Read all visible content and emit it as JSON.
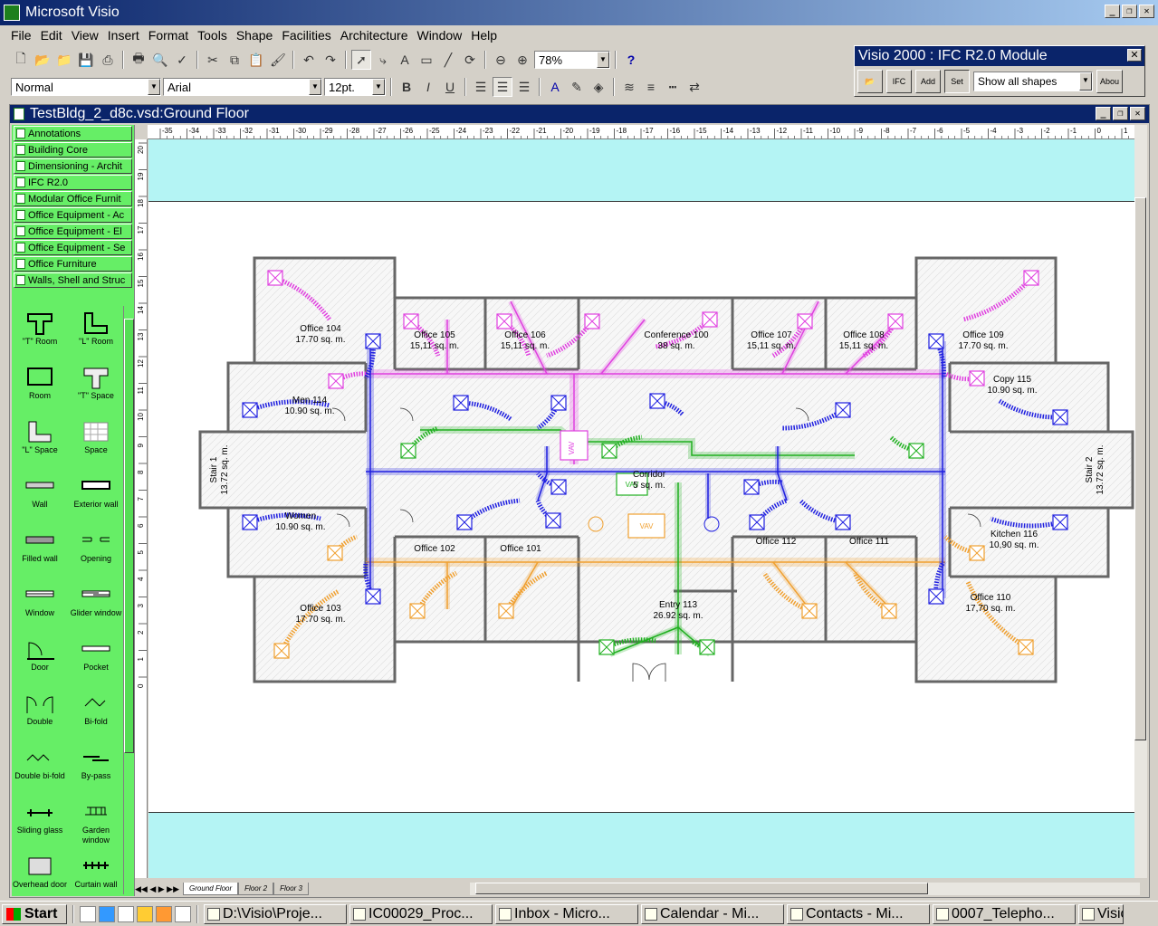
{
  "app": {
    "title": "Microsoft Visio"
  },
  "menu": [
    "File",
    "Edit",
    "View",
    "Insert",
    "Format",
    "Tools",
    "Shape",
    "Facilities",
    "Architecture",
    "Window",
    "Help"
  ],
  "toolbar": {
    "zoom": "78%",
    "style": "Normal",
    "font": "Arial",
    "size": "12pt.",
    "help": "?"
  },
  "ifc_panel": {
    "title": "Visio 2000 : IFC R2.0 Module",
    "buttons": [
      "IFC",
      "Add",
      "Set"
    ],
    "dropdown": "Show all shapes",
    "about": "Abou"
  },
  "document": {
    "title": "TestBldg_2_d8c.vsd:Ground Floor"
  },
  "stencils": [
    "Annotations",
    "Building Core",
    "Dimensioning - Archit",
    "IFC R2.0",
    "Modular Office Furnit",
    "Office Equipment - Ac",
    "Office Equipment - El",
    "Office Equipment - Se",
    "Office Furniture",
    "Walls, Shell and Struc"
  ],
  "shapes": [
    {
      "label": "\"T\" Room"
    },
    {
      "label": "\"L\" Room"
    },
    {
      "label": "Room"
    },
    {
      "label": "\"T\" Space"
    },
    {
      "label": "\"L\" Space"
    },
    {
      "label": "Space"
    },
    {
      "label": "Wall"
    },
    {
      "label": "Exterior wall"
    },
    {
      "label": "Filled wall"
    },
    {
      "label": "Opening"
    },
    {
      "label": "Window"
    },
    {
      "label": "Glider window"
    },
    {
      "label": "Door"
    },
    {
      "label": "Pocket"
    },
    {
      "label": "Double"
    },
    {
      "label": "Bi-fold"
    },
    {
      "label": "Double bi-fold"
    },
    {
      "label": "By-pass"
    },
    {
      "label": "Sliding glass"
    },
    {
      "label": "Garden window"
    },
    {
      "label": "Overhead door"
    },
    {
      "label": "Curtain wall"
    }
  ],
  "ruler_h": [
    "-35",
    "-34",
    "-33",
    "-32",
    "-31",
    "-30",
    "-29",
    "-28",
    "-27",
    "-26",
    "-25",
    "-24",
    "-23",
    "-22",
    "-21",
    "-20",
    "-19",
    "-18",
    "-17",
    "-16",
    "-15",
    "-14",
    "-13",
    "-12",
    "-11",
    "-10",
    "-9",
    "-8",
    "-7",
    "-6",
    "-5",
    "-4",
    "-3",
    "-2",
    "-1",
    "0",
    "1",
    "2"
  ],
  "ruler_v": [
    "20",
    "19",
    "18",
    "17",
    "16",
    "15",
    "14",
    "13",
    "12",
    "11",
    "10",
    "9",
    "8",
    "7",
    "6",
    "5",
    "4",
    "3",
    "2",
    "1",
    "0"
  ],
  "rooms": [
    {
      "name": "Office 104",
      "area": "17.70 sq. m."
    },
    {
      "name": "Office 105",
      "area": "15,11 sq. m."
    },
    {
      "name": "Office 106",
      "area": "15,11 sq. m."
    },
    {
      "name": "Conference 100",
      "area": "38 sq. m."
    },
    {
      "name": "Office 107",
      "area": "15,11 sq. m."
    },
    {
      "name": "Office 108",
      "area": "15,11 sq. m."
    },
    {
      "name": "Office 109",
      "area": "17.70 sq. m."
    },
    {
      "name": "Men 114",
      "area": "10.90 sq. m."
    },
    {
      "name": "Copy 115",
      "area": "10.90 sq. m."
    },
    {
      "name": "Stair 1",
      "area": "13.72 sq. m."
    },
    {
      "name": "Stair 2",
      "area": "13.72 sq. m."
    },
    {
      "name": "Corridor",
      "area": "5 sq. m."
    },
    {
      "name": "Women",
      "area": "10.90 sq. m."
    },
    {
      "name": "Kitchen 116",
      "area": "10,90 sq. m."
    },
    {
      "name": "Office 102",
      "area": ""
    },
    {
      "name": "Office 101",
      "area": ""
    },
    {
      "name": "Office 112",
      "area": ""
    },
    {
      "name": "Office 111",
      "area": ""
    },
    {
      "name": "Office 103",
      "area": "17.70 sq. m."
    },
    {
      "name": "Entry 113",
      "area": "26.92 sq. m."
    },
    {
      "name": "Office 110",
      "area": "17,70 sq. m."
    }
  ],
  "vav_label": "VAV",
  "page_tabs": [
    "Ground Floor",
    "Floor 2",
    "Floor 3"
  ],
  "taskbar": {
    "start": "Start",
    "tasks": [
      "D:\\Visio\\Proje...",
      "IC00029_Proc...",
      "Inbox - Micro...",
      "Calendar - Mi...",
      "Contacts - Mi...",
      "0007_Telepho...",
      "Visio"
    ]
  },
  "colors": {
    "supply_blue": "#1f1fe0",
    "magenta": "#e040e0",
    "green": "#20b020",
    "orange": "#f0a030",
    "stencil": "#66ee66"
  }
}
